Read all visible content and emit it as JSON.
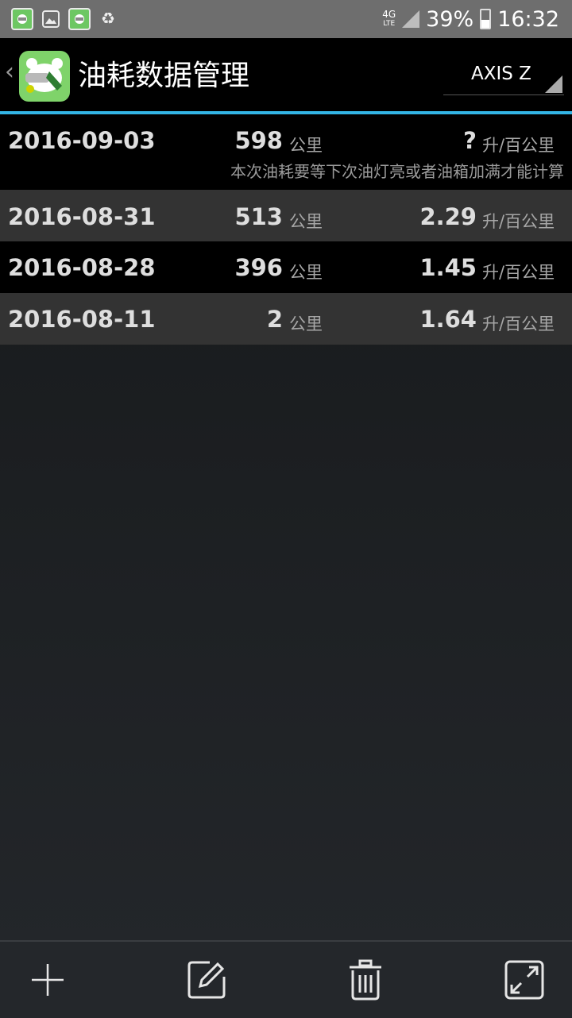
{
  "status_bar": {
    "network": "4G",
    "network_sub": "LTE",
    "battery": "39%",
    "time": "16:32"
  },
  "app_bar": {
    "title": "油耗数据管理",
    "vehicle": "AXIS Z"
  },
  "records": [
    {
      "date": "2016-09-03",
      "distance": "598",
      "distance_unit": "公里",
      "consumption": "?",
      "consumption_unit": "升/百公里",
      "note": "本次油耗要等下次油灯亮或者油箱加满才能计算"
    },
    {
      "date": "2016-08-31",
      "distance": "513",
      "distance_unit": "公里",
      "consumption": "2.29",
      "consumption_unit": "升/百公里"
    },
    {
      "date": "2016-08-28",
      "distance": "396",
      "distance_unit": "公里",
      "consumption": "1.45",
      "consumption_unit": "升/百公里"
    },
    {
      "date": "2016-08-11",
      "distance": "2",
      "distance_unit": "公里",
      "consumption": "1.64",
      "consumption_unit": "升/百公里"
    }
  ],
  "toolbar": {
    "add": "add-icon",
    "edit": "edit-icon",
    "delete": "trash-icon",
    "expand": "expand-icon"
  },
  "colors": {
    "accent": "#33b5e5",
    "row_dark": "#000000",
    "row_light": "#333333"
  }
}
